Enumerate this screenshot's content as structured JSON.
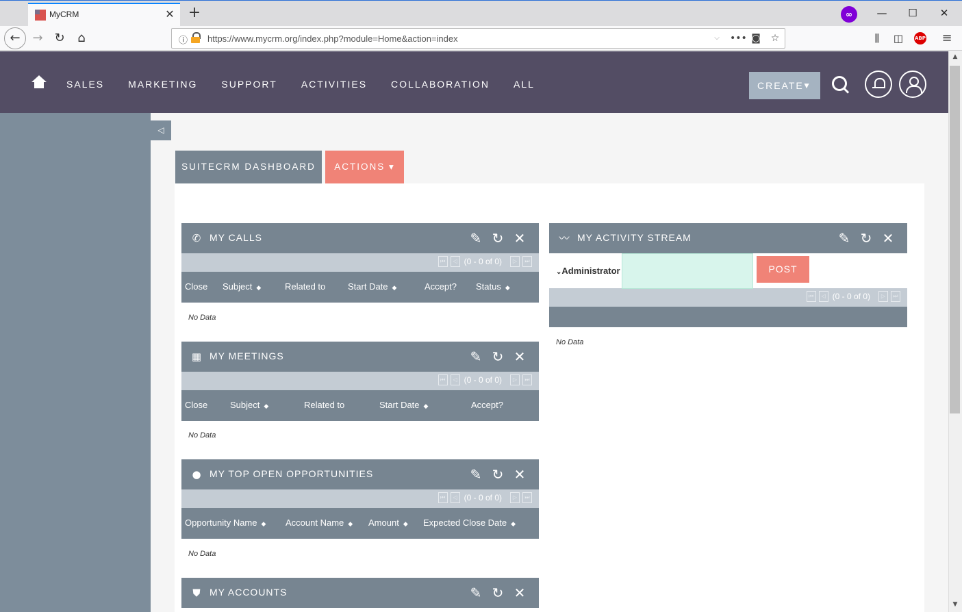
{
  "browser": {
    "tab_title": "MyCRM",
    "tab_close": "✕",
    "new_tab": "+",
    "url": "https://www.mycrm.org/index.php?module=Home&action=index",
    "window_min": "—",
    "window_max": "☐",
    "window_close": "✕",
    "page_actions": "•••",
    "abp_label": "ABP"
  },
  "header": {
    "nav": [
      "SALES",
      "MARKETING",
      "SUPPORT",
      "ACTIVITIES",
      "COLLABORATION",
      "ALL"
    ],
    "create_label": "CREATE",
    "create_caret": "▼"
  },
  "dashboard": {
    "tab_label": "SUITECRM DASHBOARD",
    "actions_label": "ACTIONS ▾"
  },
  "pager_text": "(0 - 0 of 0)",
  "no_data": "No Data",
  "dashlets": {
    "calls": {
      "title": "MY CALLS",
      "columns": [
        "Close",
        "Subject",
        "Related to",
        "Start Date",
        "Accept?",
        "Status"
      ]
    },
    "meetings": {
      "title": "MY MEETINGS",
      "columns": [
        "Close",
        "Subject",
        "Related to",
        "Start Date",
        "Accept?"
      ]
    },
    "opportunities": {
      "title": "MY TOP OPEN OPPORTUNITIES",
      "columns": [
        "Opportunity Name",
        "Account Name",
        "Amount",
        "Expected Close Date"
      ]
    },
    "accounts": {
      "title": "MY ACCOUNTS"
    },
    "activity": {
      "title": "MY ACTIVITY STREAM",
      "user": "Administrator",
      "post_label": "POST"
    }
  },
  "colors": {
    "header_bg": "#534d64",
    "dashlet_bg": "#778591",
    "accent": "#f08377",
    "sidebar": "#7d8d9b"
  }
}
